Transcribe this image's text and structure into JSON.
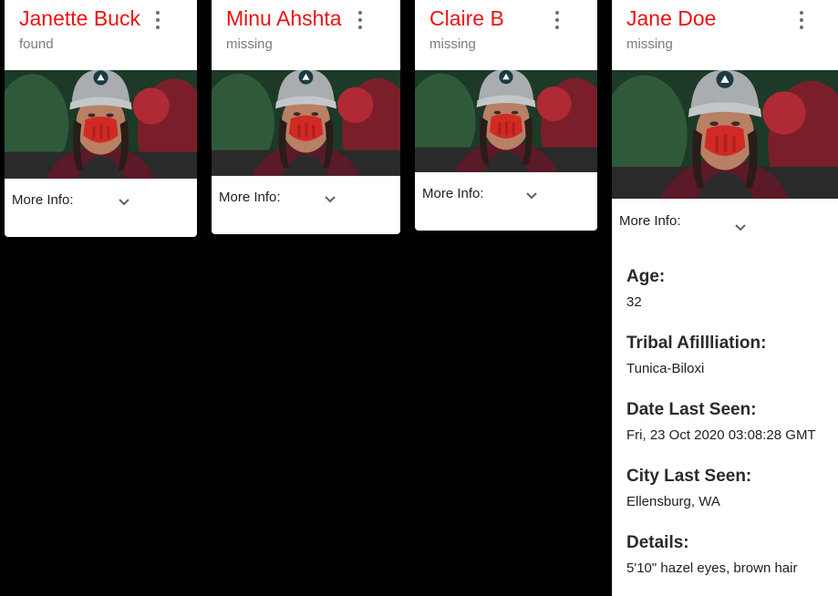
{
  "cards": [
    {
      "name": "Janette Buck",
      "status": "found",
      "more_info_label": "More Info:",
      "menu_icon": "more-vert-icon",
      "expand_icon": "chevron-down-icon"
    },
    {
      "name": "Minu Ahshta",
      "status": "missing",
      "more_info_label": "More Info:",
      "menu_icon": "more-vert-icon",
      "expand_icon": "chevron-down-icon"
    },
    {
      "name": "Claire B",
      "status": "missing",
      "more_info_label": "More Info:",
      "menu_icon": "more-vert-icon",
      "expand_icon": "chevron-down-icon"
    },
    {
      "name": "Jane Doe",
      "status": "missing",
      "more_info_label": "More Info:",
      "menu_icon": "more-vert-icon",
      "expand_icon": "chevron-down-icon"
    }
  ],
  "expanded_details": {
    "age_label": "Age:",
    "age": "32",
    "tribal_label": "Tribal Afillliation:",
    "tribal": "Tunica-Biloxi",
    "date_label": "Date Last Seen:",
    "date": "Fri, 23 Oct 2020 03:08:28 GMT",
    "city_label": "City Last Seen:",
    "city": "Ellensburg, WA",
    "details_label": "Details:",
    "details": "5'10\" hazel eyes, brown hair"
  },
  "colors": {
    "name_red": "#ee1111",
    "status_gray": "#7a7a7a",
    "background": "#000000"
  }
}
